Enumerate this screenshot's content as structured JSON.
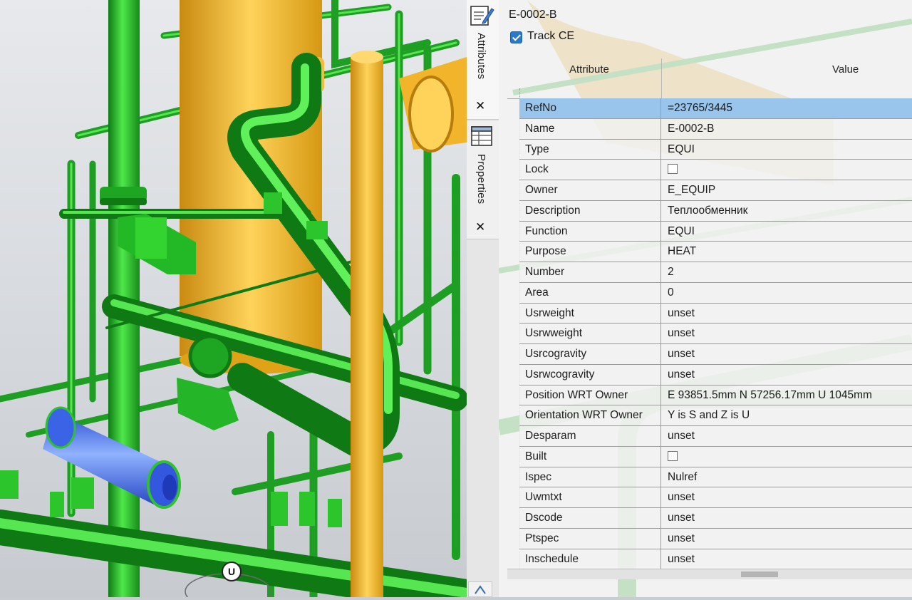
{
  "panel": {
    "ce_name": "E-0002-B",
    "track_ce_label": "Track CE",
    "track_ce_checked": true,
    "columns": {
      "attribute": "Attribute",
      "value": "Value"
    },
    "selected_row": "RefNo",
    "rows": [
      {
        "attribute": "RefNo",
        "value": "=23765/3445"
      },
      {
        "attribute": "Name",
        "value": "E-0002-B"
      },
      {
        "attribute": "Type",
        "value": "EQUI"
      },
      {
        "attribute": "Lock",
        "value": "",
        "checkbox": false
      },
      {
        "attribute": "Owner",
        "value": "E_EQUIP"
      },
      {
        "attribute": "Description",
        "value": "Теплообменник"
      },
      {
        "attribute": "Function",
        "value": "EQUI"
      },
      {
        "attribute": "Purpose",
        "value": "HEAT"
      },
      {
        "attribute": "Number",
        "value": "2"
      },
      {
        "attribute": "Area",
        "value": "0"
      },
      {
        "attribute": "Usrweight",
        "value": "unset"
      },
      {
        "attribute": "Usrwweight",
        "value": "unset"
      },
      {
        "attribute": "Usrcogravity",
        "value": "unset"
      },
      {
        "attribute": "Usrwcogravity",
        "value": "unset"
      },
      {
        "attribute": "Position WRT Owner",
        "value": "E 93851.5mm N 57256.17mm U 1045mm"
      },
      {
        "attribute": "Orientation WRT Owner",
        "value": "Y is S and Z is U"
      },
      {
        "attribute": "Desparam",
        "value": "unset"
      },
      {
        "attribute": "Built",
        "value": "",
        "checkbox": false
      },
      {
        "attribute": "Ispec",
        "value": "Nulref"
      },
      {
        "attribute": "Uwmtxt",
        "value": "unset"
      },
      {
        "attribute": "Dscode",
        "value": "unset"
      },
      {
        "attribute": "Ptspec",
        "value": "unset"
      },
      {
        "attribute": "Inschedule",
        "value": "unset"
      }
    ]
  },
  "tabs": [
    {
      "label": "Attributes",
      "icon": "edit-attributes-icon",
      "active": true
    },
    {
      "label": "Properties",
      "icon": "properties-grid-icon",
      "active": false
    }
  ],
  "viewport": {
    "compass_label": "U",
    "colors": {
      "pipe": "#2fc12f",
      "equipment": "#f2b42a",
      "selected_equipment": "#4a78f0",
      "background": "#dcdfe3"
    }
  }
}
